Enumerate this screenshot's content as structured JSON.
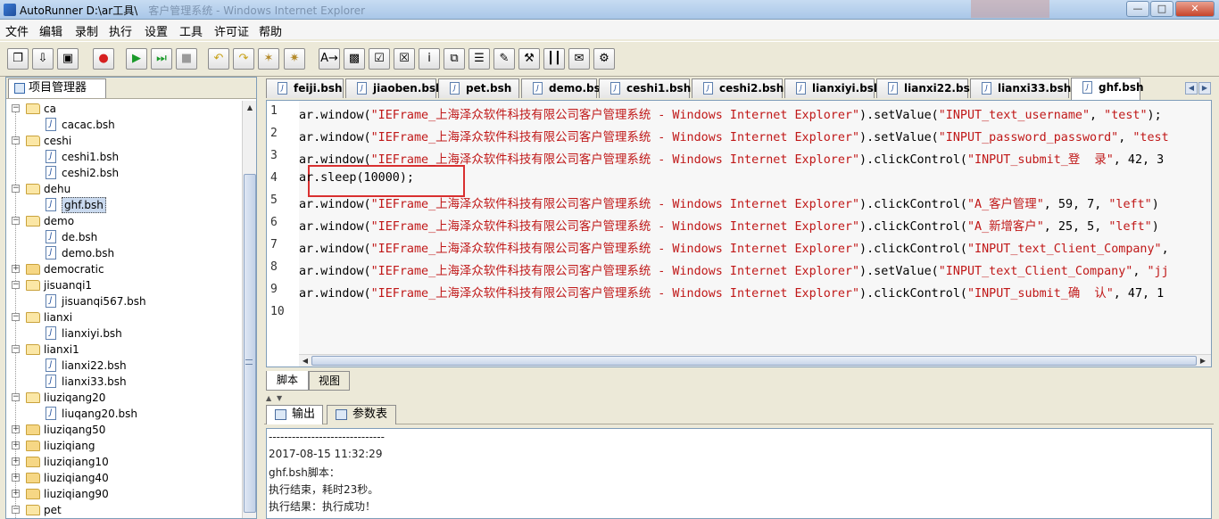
{
  "window": {
    "title": "AutoRunner  D:\\ar工具\\",
    "ghost_title": "客户管理系统 - Windows Internet Explorer",
    "min_glyph": "—",
    "max_glyph": "□",
    "close_glyph": "✕"
  },
  "menu": [
    "文件",
    "编辑",
    "录制",
    "执行",
    "设置",
    "工具",
    "许可证",
    "帮助"
  ],
  "toolbar": {
    "buttons": [
      {
        "icon": "new-script-icon",
        "glyph": "❐"
      },
      {
        "icon": "open-script-icon",
        "glyph": "⇩"
      },
      {
        "icon": "save-icon",
        "glyph": "▣"
      },
      {
        "icon": "record-icon",
        "glyph": "●",
        "color": "#d62020"
      },
      {
        "icon": "run-icon",
        "glyph": "▶",
        "color": "#1a9a2a"
      },
      {
        "icon": "run-step-icon",
        "glyph": "⏭",
        "color": "#1a9a2a"
      },
      {
        "icon": "stop-icon",
        "glyph": "■",
        "color": "#9a9a9a"
      },
      {
        "icon": "undo-icon",
        "glyph": "↶",
        "color": "#c8a21a"
      },
      {
        "icon": "redo-icon",
        "glyph": "↷",
        "color": "#c8a21a"
      },
      {
        "icon": "wand-icon",
        "glyph": "✶",
        "color": "#b48a2a"
      },
      {
        "icon": "magic-icon",
        "glyph": "✷",
        "color": "#b48a2a"
      },
      {
        "icon": "text-check-icon",
        "glyph": "A→"
      },
      {
        "icon": "image-check-icon",
        "glyph": "▩"
      },
      {
        "icon": "checkpoint-icon",
        "glyph": "☑"
      },
      {
        "icon": "checkpoint-2-icon",
        "glyph": "☒"
      },
      {
        "icon": "info-icon",
        "glyph": "i"
      },
      {
        "icon": "copy-icon",
        "glyph": "⧉"
      },
      {
        "icon": "list-check-icon",
        "glyph": "☰"
      },
      {
        "icon": "edit-check-icon",
        "glyph": "✎"
      },
      {
        "icon": "tools-icon",
        "glyph": "⚒"
      },
      {
        "icon": "columns-icon",
        "glyph": "┃┃"
      },
      {
        "icon": "comment-icon",
        "glyph": "✉"
      },
      {
        "icon": "settings-icon",
        "glyph": "⚙"
      }
    ]
  },
  "project": {
    "tab_label": "项目管理器",
    "tree": [
      {
        "label": "ca",
        "type": "folder",
        "open": true,
        "level": 0
      },
      {
        "label": "cacac.bsh",
        "type": "file",
        "level": 1
      },
      {
        "label": "ceshi",
        "type": "folder",
        "open": true,
        "level": 0
      },
      {
        "label": "ceshi1.bsh",
        "type": "file",
        "level": 1
      },
      {
        "label": "ceshi2.bsh",
        "type": "file",
        "level": 1
      },
      {
        "label": "dehu",
        "type": "folder",
        "open": true,
        "level": 0
      },
      {
        "label": "ghf.bsh",
        "type": "file",
        "level": 1,
        "selected": true
      },
      {
        "label": "demo",
        "type": "folder",
        "open": true,
        "level": 0
      },
      {
        "label": "de.bsh",
        "type": "file",
        "level": 1
      },
      {
        "label": "demo.bsh",
        "type": "file",
        "level": 1
      },
      {
        "label": "democratic",
        "type": "folder",
        "open": false,
        "level": 0
      },
      {
        "label": "jisuanqi1",
        "type": "folder",
        "open": true,
        "level": 0
      },
      {
        "label": "jisuanqi567.bsh",
        "type": "file",
        "level": 1
      },
      {
        "label": "lianxi",
        "type": "folder",
        "open": true,
        "level": 0
      },
      {
        "label": "lianxiyi.bsh",
        "type": "file",
        "level": 1
      },
      {
        "label": "lianxi1",
        "type": "folder",
        "open": true,
        "level": 0
      },
      {
        "label": "lianxi22.bsh",
        "type": "file",
        "level": 1
      },
      {
        "label": "lianxi33.bsh",
        "type": "file",
        "level": 1
      },
      {
        "label": "liuziqang20",
        "type": "folder",
        "open": true,
        "level": 0
      },
      {
        "label": "liuqang20.bsh",
        "type": "file",
        "level": 1
      },
      {
        "label": "liuziqang50",
        "type": "folder",
        "open": false,
        "level": 0
      },
      {
        "label": "liuziqiang",
        "type": "folder",
        "open": false,
        "level": 0
      },
      {
        "label": "liuziqiang10",
        "type": "folder",
        "open": false,
        "level": 0
      },
      {
        "label": "liuziqiang40",
        "type": "folder",
        "open": false,
        "level": 0
      },
      {
        "label": "liuziqiang90",
        "type": "folder",
        "open": false,
        "level": 0
      },
      {
        "label": "pet",
        "type": "folder",
        "open": true,
        "level": 0
      }
    ]
  },
  "file_tabs": [
    {
      "label": "feiji.bsh"
    },
    {
      "label": "jiaoben.bsh"
    },
    {
      "label": "pet.bsh"
    },
    {
      "label": "demo.bsh"
    },
    {
      "label": "ceshi1.bsh"
    },
    {
      "label": "ceshi2.bsh"
    },
    {
      "label": "lianxiyi.bsh"
    },
    {
      "label": "lianxi22.bsh"
    },
    {
      "label": "lianxi33.bsh"
    },
    {
      "label": "ghf.bsh",
      "active": true
    }
  ],
  "code": {
    "lines": [
      {
        "num": "1",
        "text": "ar.window(\"IEFrame_上海泽众软件科技有限公司客户管理系统 - Windows Internet Explorer\").setValue(\"INPUT_text_username\", \"test\");"
      },
      {
        "num": "2",
        "text": "ar.window(\"IEFrame_上海泽众软件科技有限公司客户管理系统 - Windows Internet Explorer\").setValue(\"INPUT_password_password\", \"test"
      },
      {
        "num": "3",
        "text": "ar.window(\"IEFrame_上海泽众软件科技有限公司客户管理系统 - Windows Internet Explorer\").clickControl(\"INPUT_submit_登  录\", 42, 3"
      },
      {
        "num": "4",
        "text": "ar.sleep(10000);"
      },
      {
        "num": "5",
        "text": "ar.window(\"IEFrame_上海泽众软件科技有限公司客户管理系统 - Windows Internet Explorer\").clickControl(\"A_客户管理\", 59, 7, \"left\")"
      },
      {
        "num": "6",
        "text": "ar.window(\"IEFrame_上海泽众软件科技有限公司客户管理系统 - Windows Internet Explorer\").clickControl(\"A_新增客户\", 25, 5, \"left\")"
      },
      {
        "num": "7",
        "text": "ar.window(\"IEFrame_上海泽众软件科技有限公司客户管理系统 - Windows Internet Explorer\").clickControl(\"INPUT_text_Client_Company\","
      },
      {
        "num": "8",
        "text": "ar.window(\"IEFrame_上海泽众软件科技有限公司客户管理系统 - Windows Internet Explorer\").setValue(\"INPUT_text_Client_Company\", \"jj"
      },
      {
        "num": "9",
        "text": "ar.window(\"IEFrame_上海泽众软件科技有限公司客户管理系统 - Windows Internet Explorer\").clickControl(\"INPUT_submit_确  认\", 47, 1"
      },
      {
        "num": "10",
        "text": ""
      }
    ],
    "string_color": "#c01818"
  },
  "view_tabs": [
    {
      "label": "脚本",
      "active": true
    },
    {
      "label": "视图",
      "active": false
    }
  ],
  "output": {
    "tabs": [
      {
        "label": "输出",
        "active": true
      },
      {
        "label": "参数表",
        "active": false
      }
    ],
    "lines": [
      "------------------------------",
      "2017-08-15 11:32:29",
      "ghf.bsh脚本：",
      "执行结束，耗时23秒。",
      "执行结果：执行成功！"
    ]
  },
  "colors": {
    "highlight_box": "#d93030",
    "accent": "#7f9db9"
  }
}
